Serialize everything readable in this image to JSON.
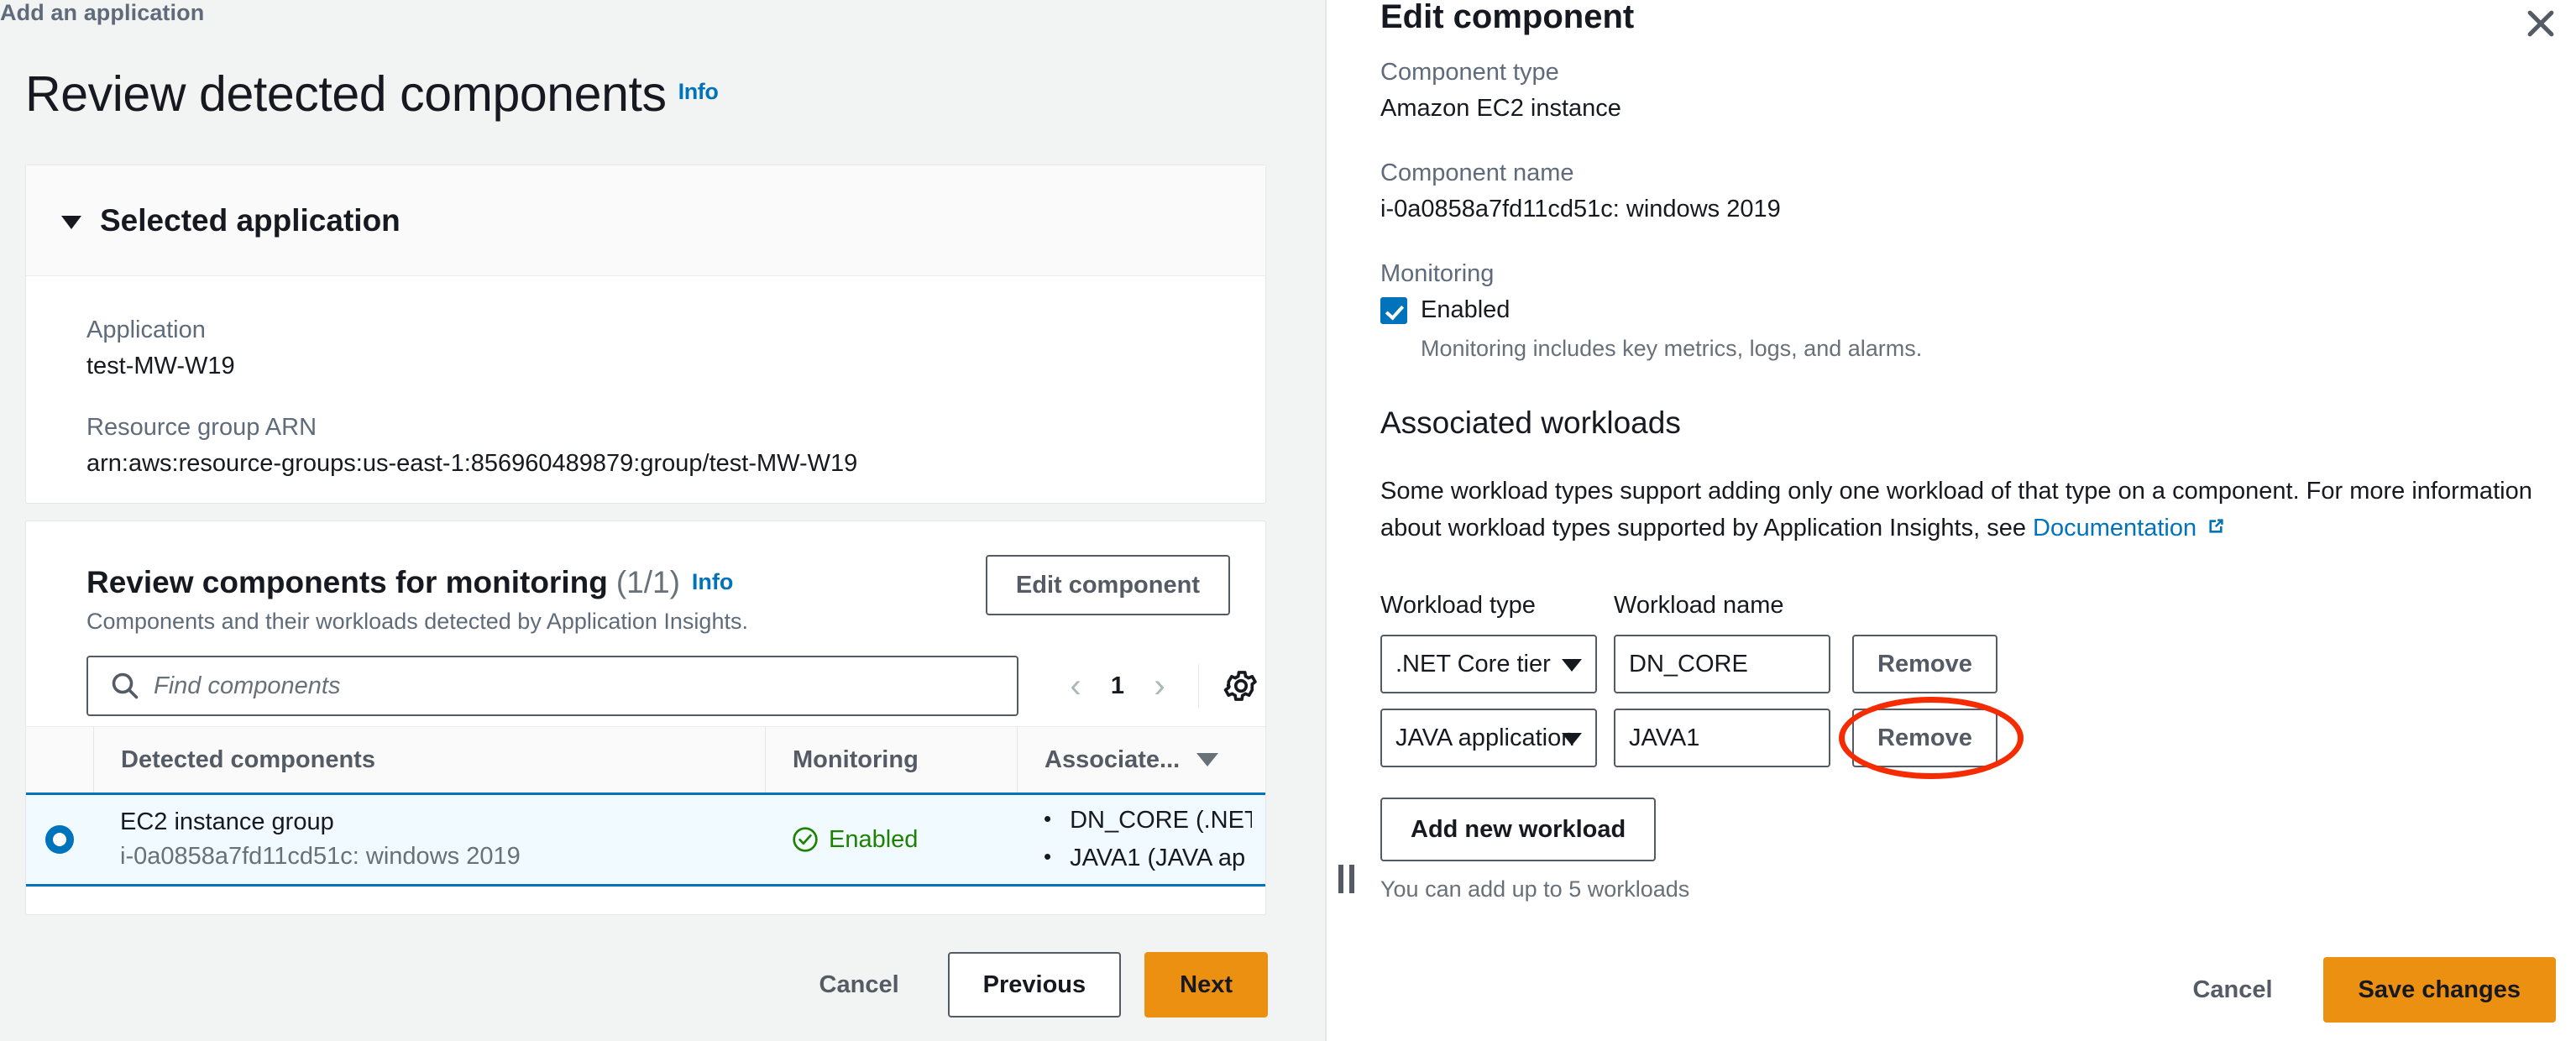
{
  "breadcrumb": "Add an application",
  "page_title": "Review detected components",
  "page_title_info": "Info",
  "selected_application": {
    "header": "Selected application",
    "application_label": "Application",
    "application_value": "test-MW-W19",
    "arn_label": "Resource group ARN",
    "arn_value": "arn:aws:resource-groups:us-east-1:856960489879:group/test-MW-W19"
  },
  "review": {
    "title": "Review components for monitoring",
    "count": "(1/1)",
    "info": "Info",
    "subtitle": "Components and their workloads detected by Application Insights.",
    "edit_component_button": "Edit component",
    "search_placeholder": "Find components",
    "search_value": "",
    "search_icon": "search-icon",
    "pager": {
      "prev": "‹",
      "page": "1",
      "next": "›",
      "settings_icon": "gear-icon"
    },
    "table": {
      "columns": [
        "Detected components",
        "Monitoring",
        "Associate..."
      ],
      "rows": [
        {
          "selected": true,
          "name": "EC2 instance group",
          "sub": "i-0a0858a7fd11cd51c: windows 2019",
          "monitoring": "Enabled",
          "workloads": [
            "DN_CORE (.NET",
            "JAVA1 (JAVA ap"
          ]
        }
      ]
    }
  },
  "left_footer": {
    "cancel": "Cancel",
    "previous": "Previous",
    "next": "Next"
  },
  "panel": {
    "title": "Edit component",
    "close_icon": "close-icon",
    "component_type_label": "Component type",
    "component_type_value": "Amazon EC2 instance",
    "component_name_label": "Component name",
    "component_name_value": "i-0a0858a7fd11cd51c: windows 2019",
    "monitoring_label": "Monitoring",
    "monitoring_checkbox_label": "Enabled",
    "monitoring_checked": true,
    "monitoring_description": "Monitoring includes key metrics, logs, and alarms.",
    "associated_workloads_title": "Associated workloads",
    "workload_info_text_1": "Some workload types support adding only one workload of that type on a component. For more information about workload types supported by Application Insights, see ",
    "workload_info_link": "Documentation",
    "workload_type_header": "Workload type",
    "workload_name_header": "Workload name",
    "workloads": [
      {
        "type": ".NET Core tier",
        "name": "DN_CORE",
        "remove": "Remove",
        "highlighted": false
      },
      {
        "type": "JAVA application",
        "name": "JAVA1",
        "remove": "Remove",
        "highlighted": true
      }
    ],
    "add_workload_button": "Add new workload",
    "workload_hint": "You can add up to 5 workloads",
    "footer": {
      "cancel": "Cancel",
      "save": "Save changes"
    }
  },
  "colors": {
    "accent_blue": "#0073bb",
    "primary_orange": "#ec9012",
    "success_green": "#1d8102",
    "highlight_red": "#f52c02",
    "row_selected_bg": "#f1faff"
  }
}
